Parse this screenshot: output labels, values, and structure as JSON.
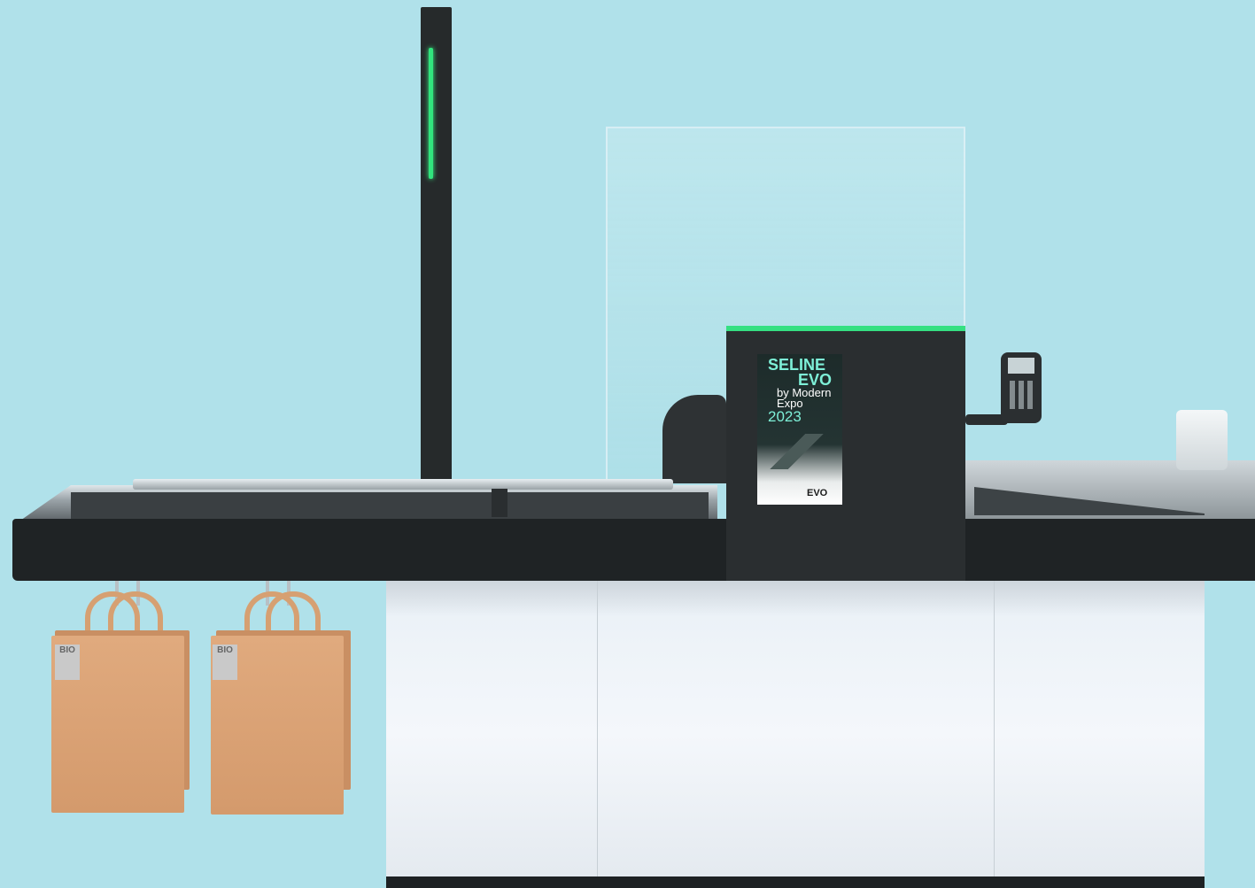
{
  "scene": {
    "subject": "self-checkout",
    "background_color": "#b0e1ea",
    "accent_color": "#35e082"
  },
  "poster": {
    "line1": "SELINE",
    "line2": "EVO",
    "line3": "by Modern",
    "line4": "Expo",
    "year": "2023",
    "logo": "EVO"
  },
  "bags": {
    "label_text": "BIO"
  }
}
